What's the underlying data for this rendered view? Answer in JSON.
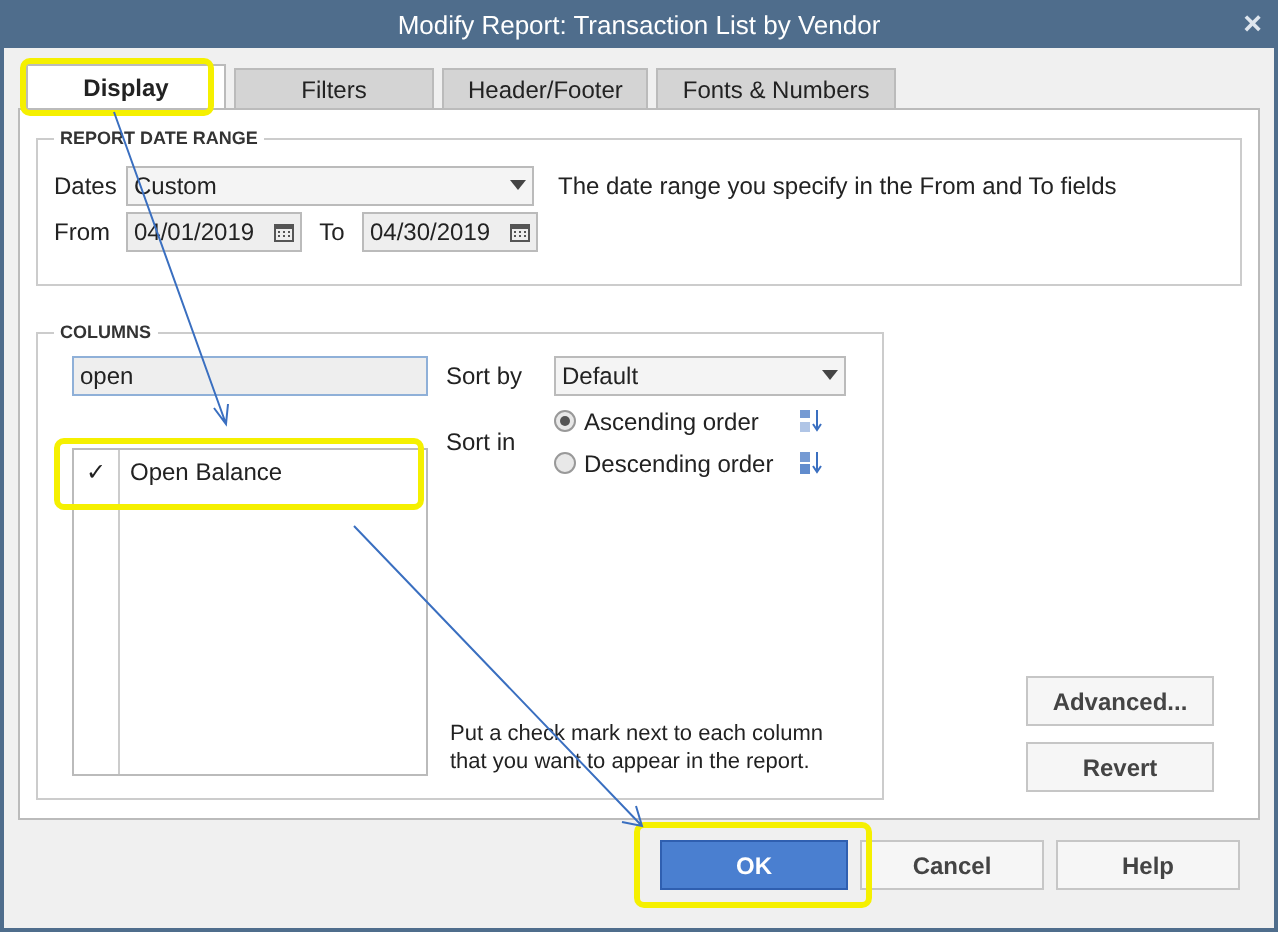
{
  "window": {
    "title": "Modify Report: Transaction List by Vendor",
    "close": "×"
  },
  "tabs": [
    {
      "label": "Display",
      "selected": true
    },
    {
      "label": "Filters",
      "selected": false
    },
    {
      "label": "Header/Footer",
      "selected": false
    },
    {
      "label": "Fonts & Numbers",
      "selected": false
    }
  ],
  "date_range": {
    "title": "REPORT DATE RANGE",
    "dates_label": "Dates",
    "dates_value": "Custom",
    "hint": "The date range you specify in the From and To fields",
    "from_label": "From",
    "from_value": "04/01/2019",
    "to_label": "To",
    "to_value": "04/30/2019"
  },
  "columns": {
    "title": "COLUMNS",
    "search": "open",
    "items": [
      {
        "label": "Open Balance",
        "checked": true,
        "check": "✓"
      }
    ],
    "sort_by_label": "Sort by",
    "sort_by_value": "Default",
    "sort_in_label": "Sort in",
    "sort_orders": [
      {
        "label": "Ascending order",
        "selected": true,
        "kind": "ascending"
      },
      {
        "label": "Descending order",
        "selected": false,
        "kind": "descending"
      }
    ],
    "note": "Put a check mark next to each column that you want to appear in the report."
  },
  "side_buttons": [
    "Advanced...",
    "Revert"
  ],
  "footer_buttons": [
    {
      "label": "OK",
      "kind": "primary"
    },
    {
      "label": "Cancel",
      "kind": "normal"
    },
    {
      "label": "Help",
      "kind": "normal"
    }
  ]
}
